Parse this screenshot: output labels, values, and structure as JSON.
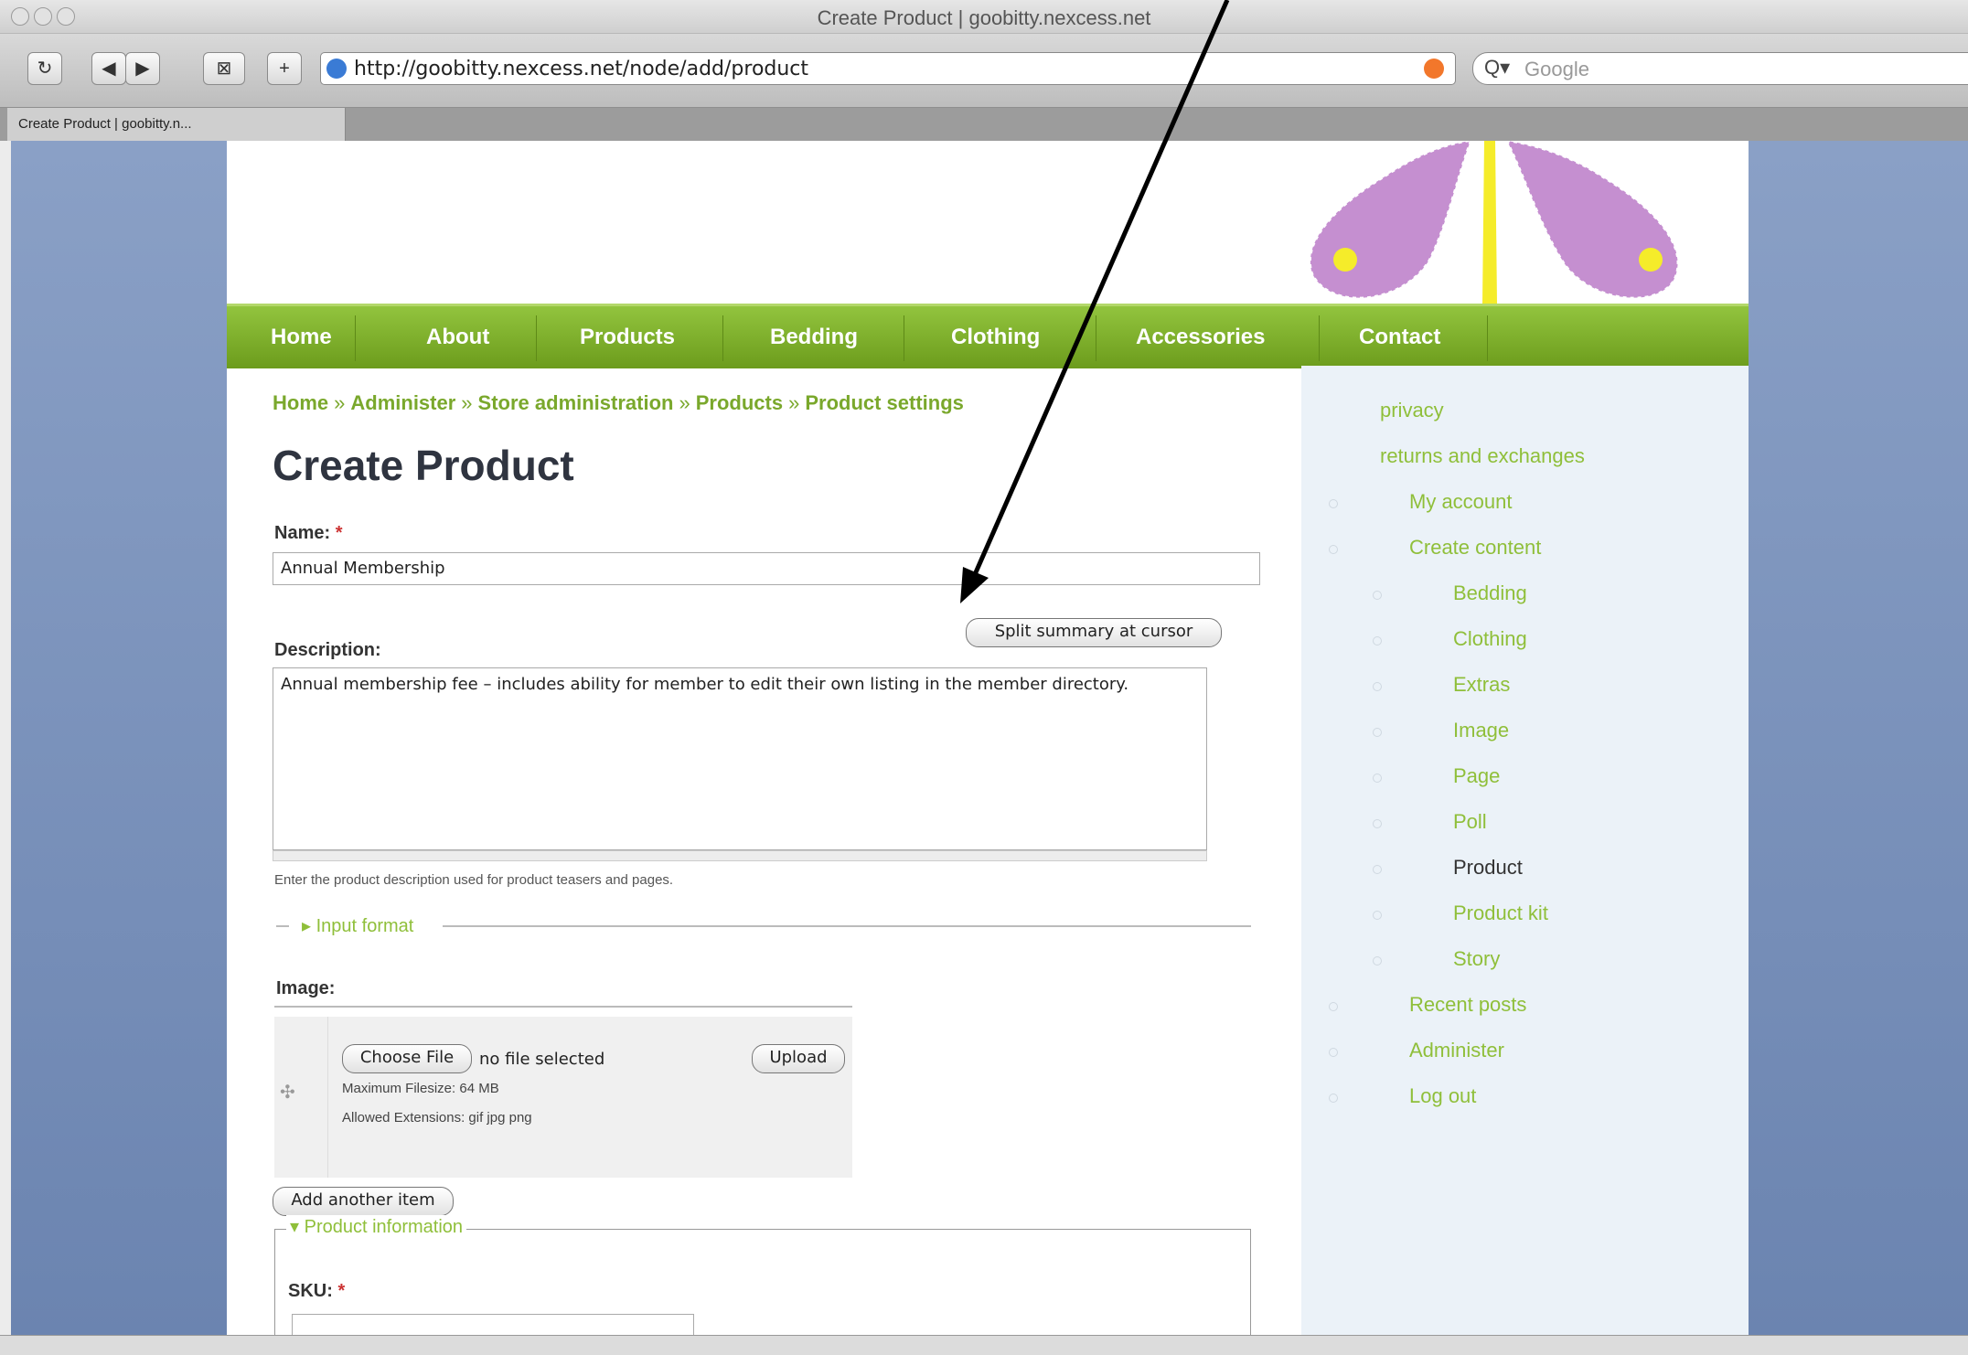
{
  "window": {
    "title": "Create Product | goobitty.nexcess.net",
    "url": "http://goobitty.nexcess.net/node/add/product",
    "search_placeholder": "Google",
    "tab_title": "Create Product | goobitty.n..."
  },
  "site": {
    "nav": [
      "Home",
      "About",
      "Products",
      "Bedding",
      "Clothing",
      "Accessories",
      "Contact"
    ],
    "breadcrumb": [
      "Home",
      "Administer",
      "Store administration",
      "Products",
      "Product settings"
    ],
    "breadcrumb_sep": "»"
  },
  "form": {
    "page_title": "Create Product",
    "name_label": "Name:",
    "required_mark": "*",
    "name_value": "Annual Membership",
    "split_button": "Split summary at cursor",
    "description_label": "Description:",
    "description_value": "Annual membership fee – includes ability for member to edit their own listing in the member directory.",
    "description_help": "Enter the product description used for product teasers and pages.",
    "input_format_legend": "Input format",
    "image_label": "Image:",
    "choose_file_button": "Choose File",
    "no_file_text": "no file selected",
    "upload_button": "Upload",
    "max_filesize": "Maximum Filesize: 64 MB",
    "allowed_extensions": "Allowed Extensions: gif jpg png",
    "add_item_button": "Add another item",
    "product_info_legend": "Product information",
    "sku_label": "SKU:"
  },
  "sidebar": {
    "items": [
      {
        "label": "privacy",
        "level": 0
      },
      {
        "label": "returns and exchanges",
        "level": 0
      },
      {
        "label": "My account",
        "level": 1
      },
      {
        "label": "Create content",
        "level": 1
      },
      {
        "label": "Bedding",
        "level": 2
      },
      {
        "label": "Clothing",
        "level": 2
      },
      {
        "label": "Extras",
        "level": 2
      },
      {
        "label": "Image",
        "level": 2
      },
      {
        "label": "Page",
        "level": 2
      },
      {
        "label": "Poll",
        "level": 2
      },
      {
        "label": "Product",
        "level": 2,
        "active": true
      },
      {
        "label": "Product kit",
        "level": 2
      },
      {
        "label": "Story",
        "level": 2
      },
      {
        "label": "Recent posts",
        "level": 1
      },
      {
        "label": "Administer",
        "level": 1
      },
      {
        "label": "Log out",
        "level": 1
      }
    ]
  },
  "colors": {
    "nav_green": "#7fb02c",
    "link_green": "#8fbf3a",
    "butterfly_purple": "#c58fd0",
    "butterfly_yellow": "#f5ec2a"
  }
}
